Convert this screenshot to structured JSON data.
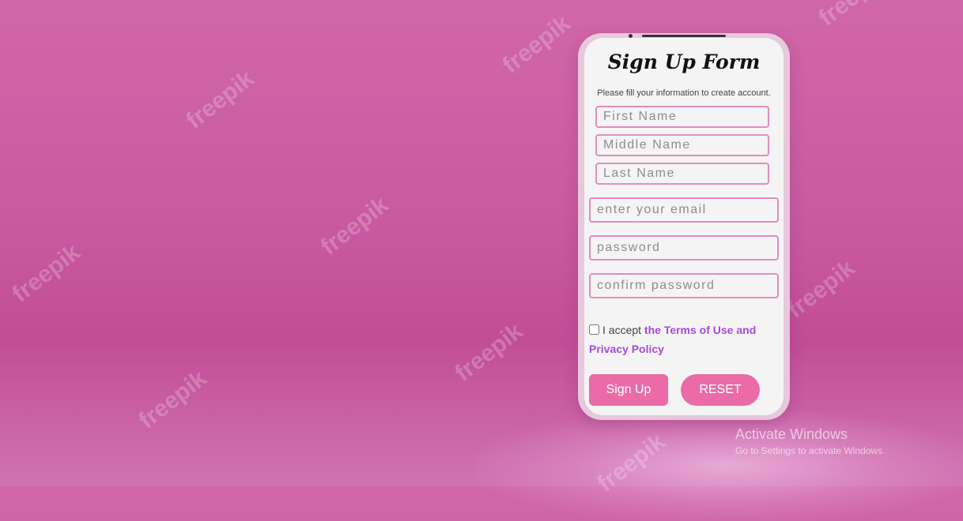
{
  "watermark": {
    "text": "freepik"
  },
  "form": {
    "title": "Sign Up Form",
    "subtitle": "Please fill your information to create account.",
    "first_name_placeholder": "First Name",
    "middle_name_placeholder": "Middle Name",
    "last_name_placeholder": "Last Name",
    "email_placeholder": "enter your email",
    "password_placeholder": "password",
    "confirm_password_placeholder": "confirm password",
    "terms_prefix": "I accept",
    "terms_link": "the Terms of Use and Privacy Policy",
    "terms_checked": false,
    "signup_label": "Sign Up",
    "reset_label": "RESET"
  },
  "windows_notice": {
    "line1": "Activate Windows",
    "line2": "Go to Settings to activate Windows."
  },
  "colors": {
    "background": "#c95aa1",
    "button": "#ea6ba8",
    "field_border": "#e38cc0",
    "link": "#a64bd8"
  }
}
